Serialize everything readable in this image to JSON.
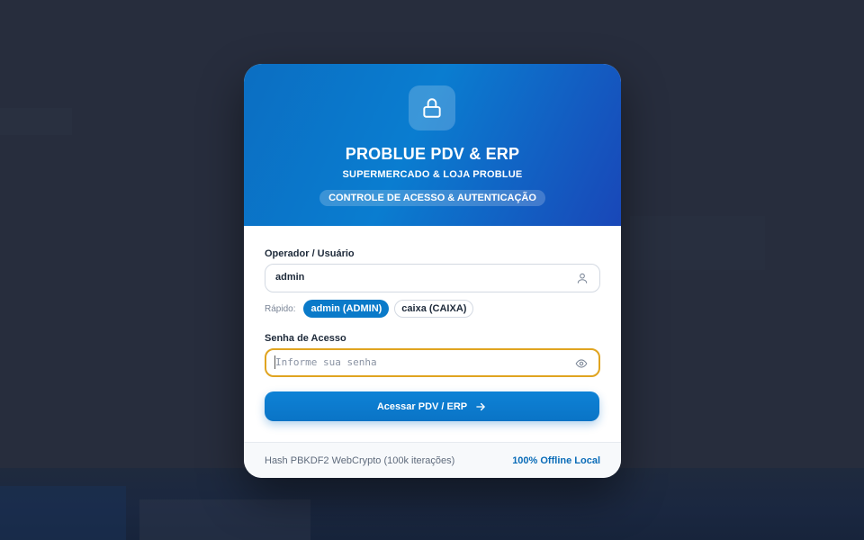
{
  "header": {
    "title": "PROBLUE PDV & ERP",
    "subtitle": "SUPERMERCADO & LOJA PROBLUE",
    "tag": "CONTROLE DE ACESSO & AUTENTICAÇÃO",
    "icon": "lock-icon"
  },
  "form": {
    "user_label": "Operador / Usuário",
    "user_value": "admin",
    "user_icon": "user-icon",
    "quick_label": "Rápido:",
    "quick_options": [
      "admin (ADMIN)",
      "caixa (CAIXA)"
    ],
    "password_label": "Senha de Acesso",
    "password_placeholder": "Informe sua senha",
    "password_icon": "eye-icon",
    "submit_label": "Acessar PDV / ERP",
    "submit_icon": "arrow-right-icon"
  },
  "footer": {
    "hash_info": "Hash PBKDF2 WebCrypto (100k iterações)",
    "offline_info": "100% Offline Local"
  },
  "colors": {
    "accent": "#0a7ac9",
    "focus_border": "#e0a420",
    "header_gradient_start": "#0b6ec2",
    "header_gradient_end": "#1947b8"
  }
}
